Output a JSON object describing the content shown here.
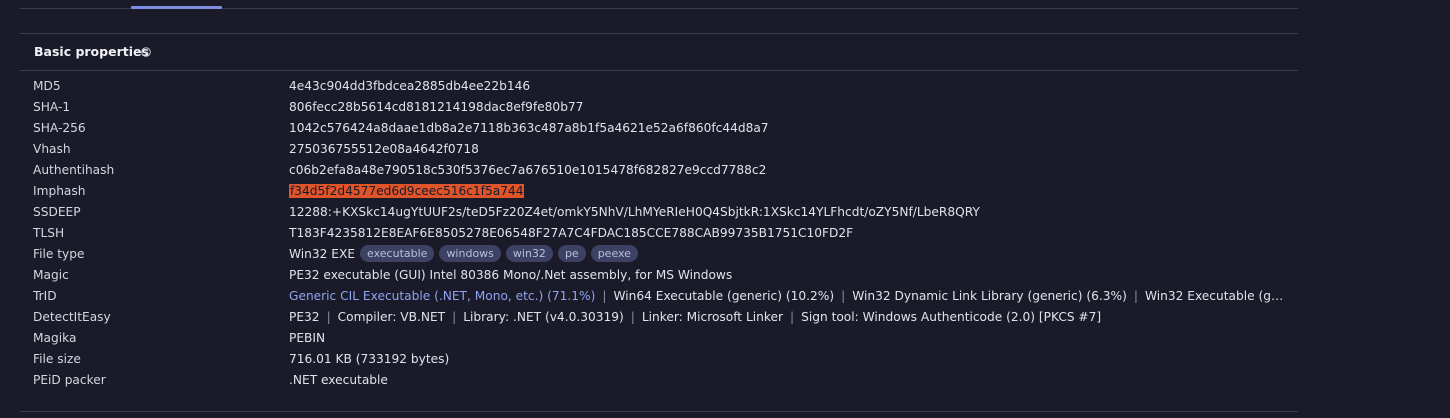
{
  "section": {
    "title": "Basic properties",
    "info_icon": "info-circle-icon"
  },
  "properties": {
    "md5": {
      "label": "MD5",
      "value": "4e43c904dd3fbdcea2885db4ee22b146"
    },
    "sha1": {
      "label": "SHA-1",
      "value": "806fecc28b5614cd8181214198dac8ef9fe80b77"
    },
    "sha256": {
      "label": "SHA-256",
      "value": "1042c576424a8daae1db8a2e7118b363c487a8b1f5a4621e52a6f860fc44d8a7"
    },
    "vhash": {
      "label": "Vhash",
      "value": "275036755512e08a4642f0718"
    },
    "authentihash": {
      "label": "Authentihash",
      "value": "c06b2efa8a48e790518c530f5376ec7a676510e1015478f682827e9ccd7788c2"
    },
    "imphash": {
      "label": "Imphash",
      "value": "f34d5f2d4577ed6d9ceec516c1f5a744"
    },
    "ssdeep": {
      "label": "SSDEEP",
      "value": "12288:+KXSkc14ugYtUUF2s/teD5Fz20Z4et/omkY5NhV/LhMYeRIeH0Q4SbjtkR:1XSkc14YLFhcdt/oZY5Nf/LbeR8QRY"
    },
    "tlsh": {
      "label": "TLSH",
      "value": "T183F4235812E8EAF6E8505278E06548F27A7C4FDAC185CCE788CAB99735B1751C10FD2F"
    },
    "file_type": {
      "label": "File type",
      "value": "Win32 EXE",
      "tags": [
        "executable",
        "windows",
        "win32",
        "pe",
        "peexe"
      ]
    },
    "magic": {
      "label": "Magic",
      "value": "PE32 executable (GUI) Intel 80386 Mono/.Net assembly, for MS Windows"
    },
    "trid": {
      "label": "TrID",
      "items": [
        "Generic CIL Executable (.NET, Mono, etc.) (71.1%)",
        "Win64 Executable (generic) (10.2%)",
        "Win32 Dynamic Link Library (generic) (6.3%)",
        "Win32 Executable (generic) (4.…"
      ]
    },
    "detectiteasy": {
      "label": "DetectItEasy",
      "items": [
        "PE32",
        "Compiler: VB.NET",
        "Library: .NET (v4.0.30319)",
        "Linker: Microsoft Linker",
        "Sign tool: Windows Authenticode (2.0) [PKCS #7]"
      ]
    },
    "magika": {
      "label": "Magika",
      "value": "PEBIN"
    },
    "file_size": {
      "label": "File size",
      "value": "716.01 KB (733192 bytes)"
    },
    "peid_packer": {
      "label": "PEiD packer",
      "value": ".NET executable"
    }
  },
  "colors": {
    "background": "#1a1a29",
    "divider": "#3a3b52",
    "tab_indicator": "#7c8fe2",
    "highlight": "#e0542a",
    "link": "#8fa3f0",
    "tag_bg": "#3d4264"
  }
}
